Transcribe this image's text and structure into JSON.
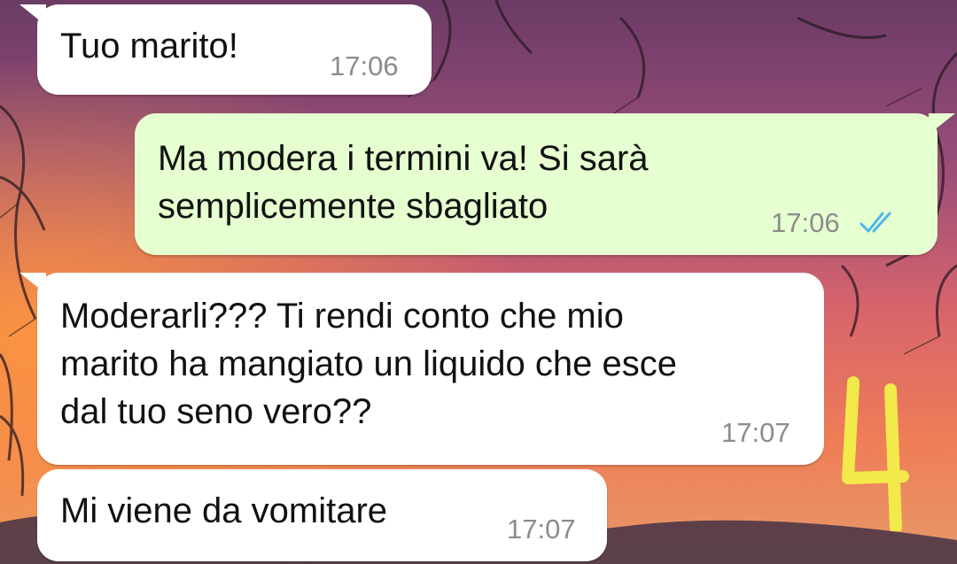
{
  "chat": {
    "messages": [
      {
        "direction": "incoming",
        "text": "Tuo marito!",
        "time": "17:06"
      },
      {
        "direction": "outgoing",
        "text": "Ma modera i termini va! Si sarà\nsemplicemente sbagliato",
        "time": "17:06",
        "status": "read-double-check"
      },
      {
        "direction": "incoming",
        "text": "Moderarli??? Ti rendi conto che mio\nmarito ha mangiato un liquido che esce\ndal tuo seno vero??",
        "time": "17:07"
      },
      {
        "direction": "incoming",
        "text": "Mi viene da vomitare",
        "time": "17:07"
      }
    ]
  },
  "overlay": {
    "page_number_handwritten": "4"
  },
  "colors": {
    "incoming_bubble": "#ffffff",
    "outgoing_bubble": "#e6ffd0",
    "read_ticks": "#4fb6ec",
    "handwritten_number": "#f2e94a"
  }
}
